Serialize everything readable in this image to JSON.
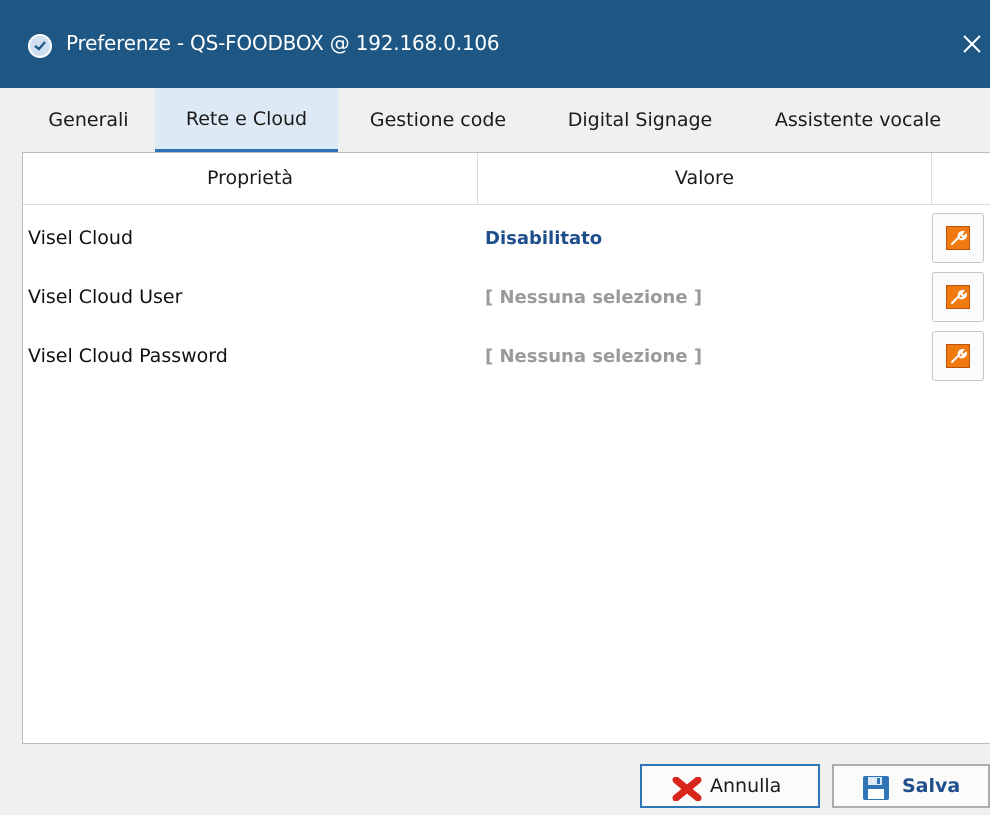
{
  "window": {
    "title": "Preferenze - QS-FOODBOX @ 192.168.0.106",
    "icon": "app-logo-icon",
    "close_icon": "close-icon"
  },
  "tabs": [
    {
      "label": "Generali",
      "active": false
    },
    {
      "label": "Rete e Cloud",
      "active": true
    },
    {
      "label": "Gestione code",
      "active": false
    },
    {
      "label": "Digital Signage",
      "active": false
    },
    {
      "label": "Assistente vocale",
      "active": false
    }
  ],
  "grid": {
    "columns": [
      "Proprietà",
      "Valore",
      ""
    ],
    "rows": [
      {
        "property": "Visel Cloud",
        "value": "Disabilitato",
        "value_style": "set"
      },
      {
        "property": "Visel Cloud User",
        "value": "[ Nessuna selezione ]",
        "value_style": "empty"
      },
      {
        "property": "Visel Cloud Password",
        "value": "[ Nessuna selezione ]",
        "value_style": "empty"
      }
    ],
    "edit_icon": "wrench-icon"
  },
  "buttons": {
    "cancel_label": "Annulla",
    "cancel_icon": "red-x-icon",
    "save_label": "Salva",
    "save_icon": "floppy-disk-icon"
  },
  "colors": {
    "titlebar": "#1f5784",
    "accent": "#2f74b5",
    "set_value": "#1f4e8c",
    "empty_value": "#9a9a9a",
    "edit_button": "#f07a10",
    "cancel_icon": "#d9261c"
  }
}
